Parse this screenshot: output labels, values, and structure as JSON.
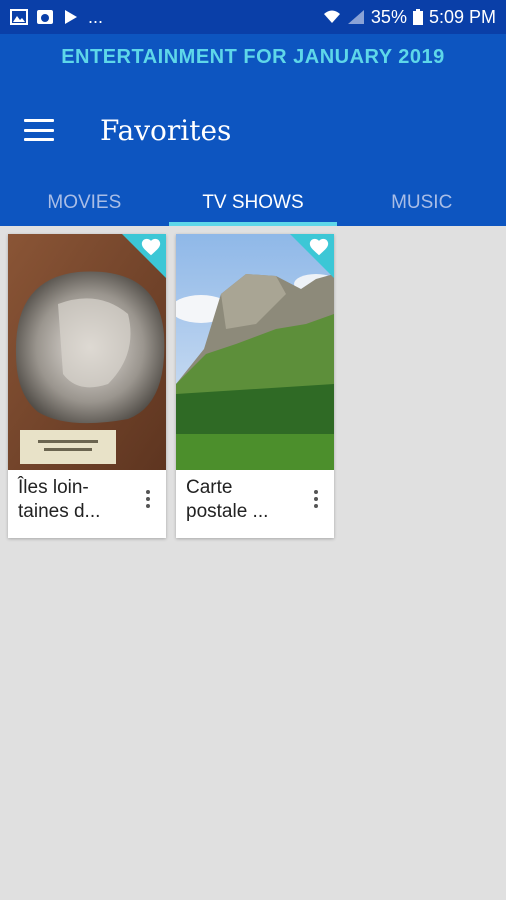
{
  "status_bar": {
    "overflow": "...",
    "battery": "35%",
    "time": "5:09 PM",
    "icons": [
      "image-icon",
      "weather-icon",
      "play-icon",
      "wifi-icon",
      "signal-icon",
      "battery-icon"
    ]
  },
  "header": {
    "banner": "ENTERTAINMENT FOR JANUARY 2019",
    "title": "Favorites",
    "colors": {
      "background": "#0d55c0",
      "accent": "#5ed7e9"
    }
  },
  "tabs": [
    {
      "label": "MOVIES",
      "active": false
    },
    {
      "label": "TV SHOWS",
      "active": true
    },
    {
      "label": "MUSIC",
      "active": false
    }
  ],
  "favorites": [
    {
      "title": "Îles loin-\ntaines d...",
      "thumbnail": "shell-photo",
      "favorited": true
    },
    {
      "title": "Carte\npostale ...",
      "thumbnail": "mountain-photo",
      "favorited": true
    }
  ]
}
